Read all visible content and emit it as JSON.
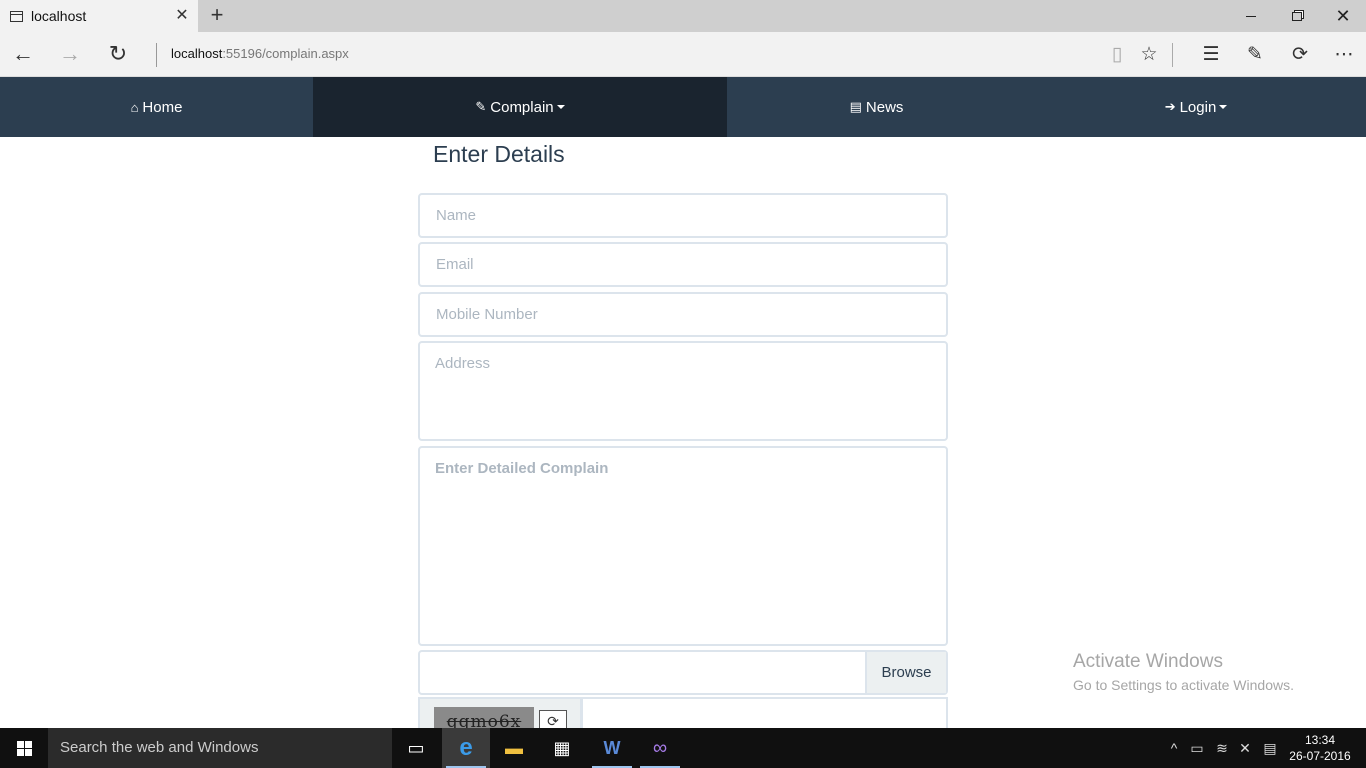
{
  "browser": {
    "tab_title": "localhost",
    "url_host": "localhost",
    "url_path": ":55196/complain.aspx",
    "icons": [
      "page-icon",
      "close-icon",
      "plus-icon",
      "back-arrow-icon",
      "forward-arrow-icon",
      "refresh-icon",
      "reading-view-icon",
      "star-icon",
      "hub-icon",
      "web-note-icon",
      "share-icon",
      "more-icon"
    ]
  },
  "nav": {
    "items": [
      {
        "label": "Home",
        "icon": "home-icon"
      },
      {
        "label": "Complain",
        "icon": "edit-icon"
      },
      {
        "label": "News",
        "icon": "newspaper-icon"
      },
      {
        "label": "Login",
        "icon": "sign-in-icon"
      }
    ],
    "colors": {
      "bar": "#2c3e50",
      "active": "#1a242f"
    }
  },
  "form": {
    "heading": "Enter Details",
    "name_placeholder": "Name",
    "email_placeholder": "Email",
    "mobile_placeholder": "Mobile Number",
    "address_placeholder": "Address",
    "complain_placeholder": "Enter Detailed Complain",
    "browse_label": "Browse",
    "captcha_text": "qqmo6x"
  },
  "watermark": {
    "line1": "Activate Windows",
    "line2": "Go to Settings to activate Windows."
  },
  "taskbar": {
    "search_text": "Search the web and Windows",
    "time": "13:34",
    "date": "26-07-2016"
  }
}
